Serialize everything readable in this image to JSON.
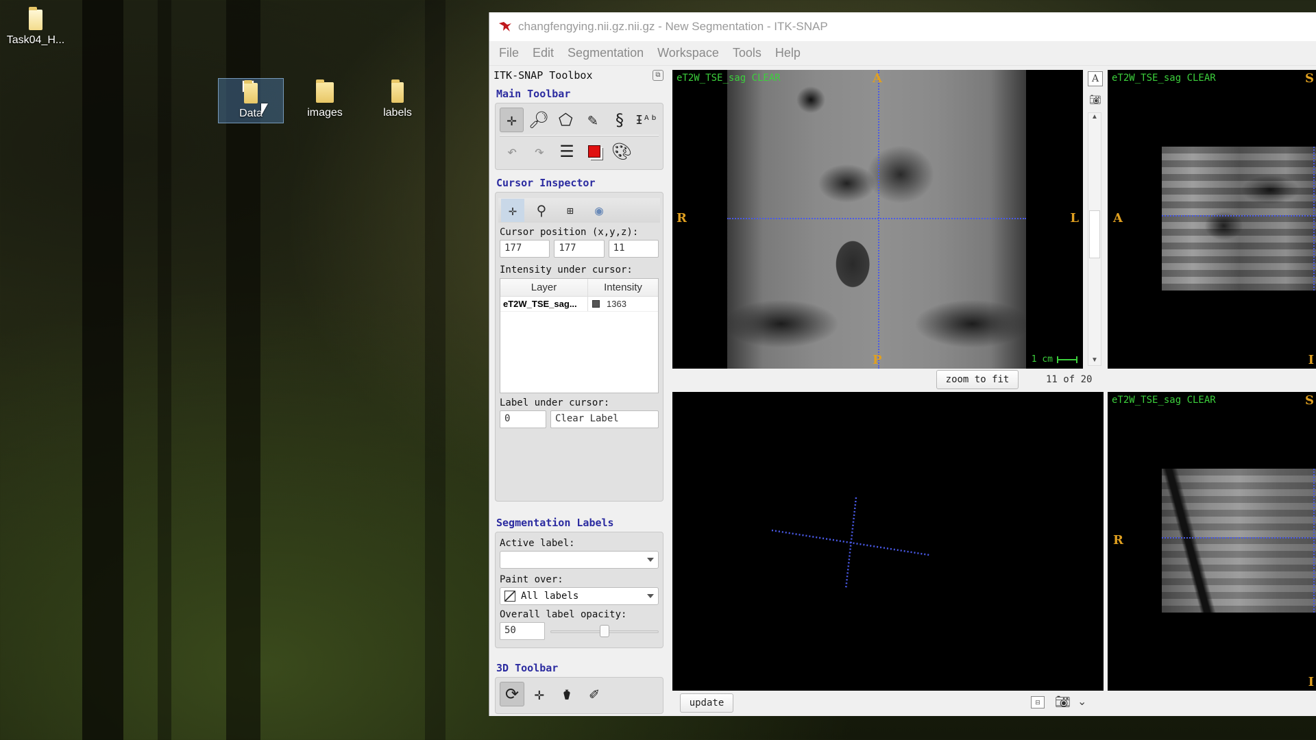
{
  "desktop": {
    "icons": [
      {
        "label": "Task04_H..."
      },
      {
        "label": "Data",
        "selected": true
      },
      {
        "label": "images"
      },
      {
        "label": "labels"
      }
    ]
  },
  "window": {
    "title": "changfengying.nii.gz.nii.gz - New Segmentation - ITK-SNAP",
    "menu": [
      "File",
      "Edit",
      "Segmentation",
      "Workspace",
      "Tools",
      "Help"
    ]
  },
  "toolbox": {
    "title": "ITK-SNAP Toolbox",
    "main_toolbar": {
      "title": "Main Toolbar",
      "tools": [
        "crosshair-tool",
        "zoom-tool",
        "polygon-tool",
        "paintbrush-tool",
        "snake-tool",
        "annotation-tool"
      ],
      "active_tool": "crosshair-tool",
      "actions": [
        "undo",
        "redo",
        "layers",
        "label-color",
        "palette"
      ]
    },
    "cursor_inspector": {
      "title": "Cursor Inspector",
      "position_label": "Cursor position (x,y,z):",
      "x": "177",
      "y": "177",
      "z": "11",
      "intensity_label": "Intensity under cursor:",
      "table": {
        "headers": [
          "Layer",
          "Intensity"
        ],
        "rows": [
          {
            "layer": "eT2W_TSE_sag...",
            "intensity": "1363"
          }
        ]
      },
      "label_under_cursor_label": "Label under cursor:",
      "label_id": "0",
      "label_name": "Clear Label"
    },
    "segmentation_labels": {
      "title": "Segmentation Labels",
      "active_label_label": "Active label:",
      "active_label_value": "",
      "paint_over_label": "Paint over:",
      "paint_over_value": "All labels",
      "opacity_label": "Overall label opacity:",
      "opacity_value": "50",
      "opacity_fraction": 0.5
    },
    "toolbar_3d": {
      "title": "3D Toolbar",
      "tools": [
        "rotate-tool",
        "crosshair-3d-tool",
        "spray-tool",
        "scalpel-tool"
      ],
      "active_tool": "rotate-tool"
    }
  },
  "viewports": {
    "axial": {
      "layer_name": "eT2W_TSE_sag CLEAR",
      "orientation": {
        "top": "A",
        "bottom": "P",
        "left": "R",
        "right": "L"
      },
      "scale_label": "1 cm",
      "zoom_button": "zoom to fit",
      "slice_info": "11 of 20"
    },
    "sagittal": {
      "layer_name": "eT2W_TSE_sag CLEAR",
      "orientation": {
        "top": "S",
        "bottom": "I",
        "left": "A"
      }
    },
    "coronal": {
      "layer_name": "eT2W_TSE_sag CLEAR",
      "orientation": {
        "top": "S",
        "bottom": "I",
        "left": "R"
      }
    },
    "view3d": {
      "update_button": "update"
    }
  },
  "colors": {
    "section_title": "#2b2ba0",
    "layer_name": "#3cd03c",
    "orientation": "#e0a020",
    "crosshair": "#4a5ae8"
  }
}
